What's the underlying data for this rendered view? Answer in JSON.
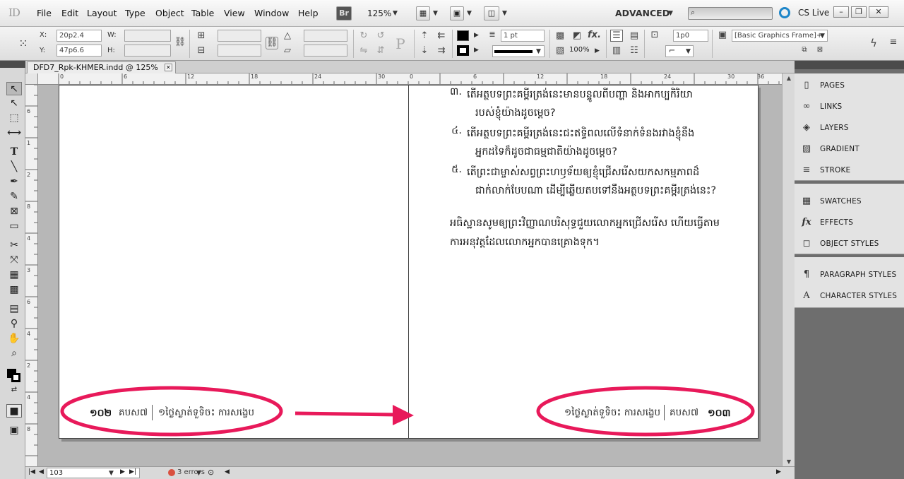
{
  "app": {
    "logo": "ID",
    "menu": [
      "File",
      "Edit",
      "Layout",
      "Type",
      "Object",
      "Table",
      "View",
      "Window",
      "Help"
    ],
    "bridge_button": "Br",
    "zoom": "125%",
    "workspace": "ADVANCED",
    "cs_live": "CS Live",
    "win_minimize": "–",
    "win_restore": "❐",
    "win_close": "✕"
  },
  "control_panel": {
    "x_label": "X:",
    "x_value": "20p2.4",
    "y_label": "Y:",
    "y_value": "47p6.6",
    "w_label": "W:",
    "h_label": "H:",
    "stroke_weight": "1 pt",
    "opacity": "100%",
    "text_wrap_value": "1p0",
    "object_style": "[Basic Graphics Frame]+"
  },
  "document": {
    "tab_title": "DFD7_Rpk-KHMER.indd @ 125%",
    "tab_close": "✕"
  },
  "ruler": {
    "left_page_ticks": [
      "0",
      "6",
      "12",
      "18",
      "24",
      "30"
    ],
    "right_page_ticks": [
      "0",
      "6",
      "12",
      "18",
      "24",
      "30",
      "36"
    ],
    "vertical_ticks": [
      "6",
      "1",
      "2",
      "8",
      "4",
      "3",
      "6",
      "4",
      "2",
      "4",
      "8"
    ]
  },
  "right_page": {
    "questions": [
      {
        "num": "៣.",
        "line1": "តើអត្ថបទព្រះគម្ពីរត្រង់នេះមានបន្ទូលពីបញ្ហា និងអាកប្បកិរិយា",
        "line2": "របស់ខ្ញុំយ៉ាងដូចម្ដេច?"
      },
      {
        "num": "៤.",
        "line1": "តើអត្ថបទព្រះគម្ពីរត្រង់នេះជះឥទ្ធិពលលើទំនាក់ទំនងរវាងខ្ញុំនឹង",
        "line2": "អ្នកដទៃក៏ដូចជាធម្មជាតិយ៉ាងដូចម្ដេច?"
      },
      {
        "num": "៥.",
        "line1": "តើព្រះជាម្ចាស់សព្វព្រះហឫទ័យឲ្យខ្ញុំជ្រើសរើសយកសកម្មភាពដ៏",
        "line2": "ជាក់លាក់បែបណា ដើម្បីឆ្លើយតបទៅនឹងអត្ថបទព្រះគម្ពីរត្រង់នេះ?"
      }
    ],
    "prayer_line1": "អធិស្ឋានសូមឲ្យព្រះវិញ្ញាណបរិសុទ្ធជួយលោកអ្នកជ្រើសរើស ហើយធ្វើតាម",
    "prayer_line2": "ការអនុវត្តដែលលោកអ្នកបានគ្រោងទុក។"
  },
  "folio": {
    "left_page_number": "១០២",
    "left_section": "គបស៧",
    "left_running_head": "១ថ្ងៃស្ងាត់ទួទិចះ ការសង្ខេប",
    "right_running_head": "១ថ្ងៃស្ងាត់ទួទិចះ ការសង្ខេប",
    "right_section": "គបស៧",
    "right_page_number": "១០៣"
  },
  "status": {
    "page": "103",
    "errors": "3 errors"
  },
  "panels": {
    "group1": [
      {
        "label": "PAGES",
        "icon": "pages-icon",
        "glyph": "▯"
      },
      {
        "label": "LINKS",
        "icon": "links-icon",
        "glyph": "∞"
      },
      {
        "label": "LAYERS",
        "icon": "layers-icon",
        "glyph": "◈"
      },
      {
        "label": "GRADIENT",
        "icon": "gradient-icon",
        "glyph": "▨"
      },
      {
        "label": "STROKE",
        "icon": "stroke-icon",
        "glyph": "≡"
      }
    ],
    "group2": [
      {
        "label": "SWATCHES",
        "icon": "swatches-icon",
        "glyph": "▦"
      },
      {
        "label": "EFFECTS",
        "icon": "effects-icon",
        "glyph": "fx"
      },
      {
        "label": "OBJECT STYLES",
        "icon": "object-styles-icon",
        "glyph": "◻"
      }
    ],
    "group3": [
      {
        "label": "PARAGRAPH STYLES",
        "icon": "paragraph-styles-icon",
        "glyph": "¶"
      },
      {
        "label": "CHARACTER STYLES",
        "icon": "character-styles-icon",
        "glyph": "A"
      }
    ]
  },
  "annotation": {
    "ellipse_color": "#e8195a",
    "arrow_color": "#e8195a"
  }
}
